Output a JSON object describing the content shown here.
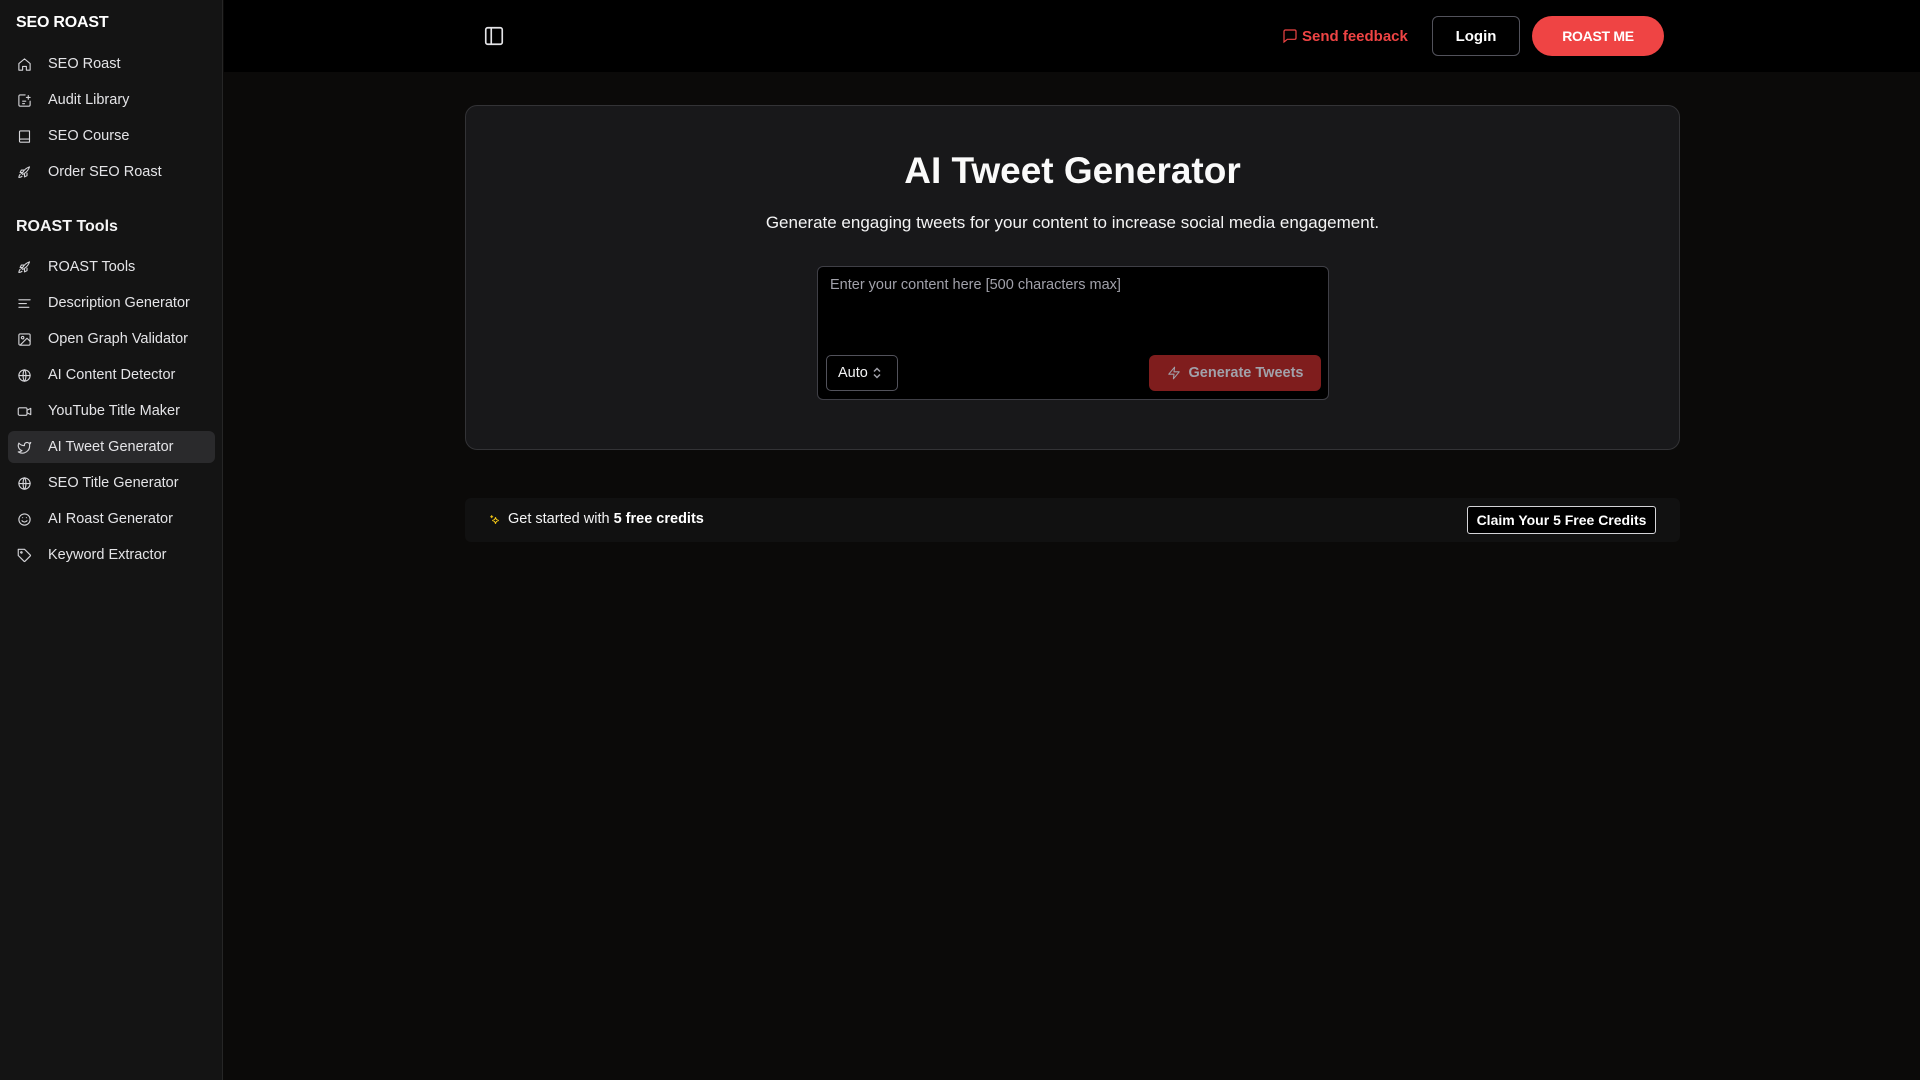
{
  "sidebar": {
    "brand": "SEO ROAST",
    "main_items": [
      {
        "label": "SEO Roast",
        "icon": "home-icon"
      },
      {
        "label": "Audit Library",
        "icon": "library-icon"
      },
      {
        "label": "SEO Course",
        "icon": "book-icon"
      },
      {
        "label": "Order SEO Roast",
        "icon": "rocket-icon"
      }
    ],
    "section_title": "ROAST Tools",
    "tool_items": [
      {
        "label": "ROAST Tools",
        "icon": "rocket-icon"
      },
      {
        "label": "Description Generator",
        "icon": "text-lines-icon"
      },
      {
        "label": "Open Graph Validator",
        "icon": "image-icon"
      },
      {
        "label": "AI Content Detector",
        "icon": "globe-icon"
      },
      {
        "label": "YouTube Title Maker",
        "icon": "video-icon"
      },
      {
        "label": "AI Tweet Generator",
        "icon": "twitter-icon",
        "active": true
      },
      {
        "label": "SEO Title Generator",
        "icon": "globe-icon"
      },
      {
        "label": "AI Roast Generator",
        "icon": "smile-icon"
      },
      {
        "label": "Keyword Extractor",
        "icon": "tag-icon"
      }
    ]
  },
  "header": {
    "feedback_label": "Send feedback",
    "login_label": "Login",
    "cta_label": "ROAST ME"
  },
  "main": {
    "title": "AI Tweet Generator",
    "subtitle": "Generate engaging tweets for your content to increase social media engagement.",
    "input_placeholder": "Enter your content here [500 characters max]",
    "input_value": "",
    "tone_selected": "Auto",
    "generate_label": "Generate Tweets"
  },
  "credits": {
    "prefix": "Get started with",
    "highlight": "5 free credits",
    "claim_label": "Claim Your 5 Free Credits"
  },
  "colors": {
    "accent": "#ef4444",
    "generate_disabled": "#7f1d1d",
    "sparkle": "#facc15"
  }
}
